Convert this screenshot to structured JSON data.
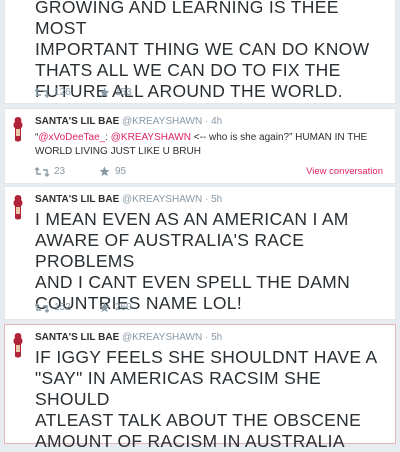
{
  "tweets": [
    {
      "body_lines": [
        "GROWING AND LEARNING IS THEE MOST",
        "IMPORTANT THING WE CAN DO KNOW",
        "THATS ALL WE CAN DO TO FIX THE",
        "FUTURE ALL AROUND THE WORLD."
      ],
      "retweets": "126",
      "favorites": "153"
    },
    {
      "name": "SANTA'S LIL BAE",
      "handle": "@KREAYSHAWN",
      "separator": "·",
      "time": "4h",
      "quote_open": "“",
      "mention1": "@xVoDeeTae_",
      "colon": ": ",
      "mention2": "@KREAYSHAWN",
      "text_line1_rest": " <-- who is she again?” HUMAN IN THE",
      "text_line2": "WORLD LIVING JUST LIKE U BRUH",
      "retweets": "23",
      "favorites": "95",
      "view_conversation": "View conversation"
    },
    {
      "name": "SANTA'S LIL BAE",
      "handle": "@KREAYSHAWN",
      "separator": "·",
      "time": "5h",
      "body_lines": [
        "I MEAN EVEN AS AN AMERICAN I AM",
        "AWARE OF AUSTRALIA'S RACE PROBLEMS",
        "AND I CANT EVEN SPELL THE DAMN",
        "COUNTRIES NAME LOL!"
      ],
      "retweets": "152",
      "favorites": "260"
    },
    {
      "name": "SANTA'S LIL BAE",
      "handle": "@KREAYSHAWN",
      "separator": "·",
      "time": "5h",
      "body_lines": [
        "IF IGGY FEELS SHE SHOULDNT HAVE A",
        "\"SAY\" IN AMERICAS RACSIM SHE SHOULD",
        "ATLEAST TALK ABOUT THE OBSCENE",
        "AMOUNT OF RACISM IN AUSTRALIA"
      ]
    }
  ],
  "colors": {
    "accent": "#e0245e",
    "muted": "#8899a6",
    "text": "#292f33",
    "background": "#e6ecf0"
  },
  "icons": [
    "avatar",
    "retweet-icon",
    "favorite-star-icon"
  ]
}
